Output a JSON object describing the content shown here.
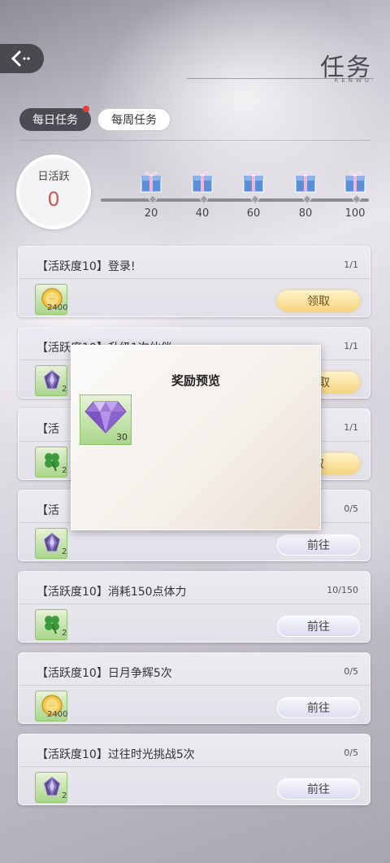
{
  "header": {
    "title": "任务",
    "subtitle": "RENWU",
    "back_icon": "back-arrow-icon"
  },
  "tabs": [
    {
      "label": "每日任务",
      "active": true,
      "has_badge": true
    },
    {
      "label": "每周任务",
      "active": false
    }
  ],
  "activity": {
    "label": "日活跃",
    "value": "0"
  },
  "milestones": [
    "20",
    "40",
    "60",
    "80",
    "100"
  ],
  "tasks": [
    {
      "title": "【活跃度10】登录!",
      "progress": "1/1",
      "reward_icon": "coin-icon",
      "reward_count": "2400",
      "button": "领取"
    },
    {
      "title": "【活跃度10】升级1次伙伴",
      "progress": "1/1",
      "reward_icon": "crystal-icon",
      "reward_count": "2",
      "button": "领取"
    },
    {
      "title": "【活",
      "progress": "1/1",
      "reward_icon": "clover-icon",
      "reward_count": "2",
      "button": "取"
    },
    {
      "title": "【活",
      "progress": "0/5",
      "reward_icon": "crystal-icon",
      "reward_count": "2",
      "button": "前往"
    },
    {
      "title": "【活跃度10】消耗150点体力",
      "progress": "10/150",
      "reward_icon": "clover-icon",
      "reward_count": "2",
      "button": "前往"
    },
    {
      "title": "【活跃度10】日月争辉5次",
      "progress": "0/5",
      "reward_icon": "coin-icon",
      "reward_count": "2400",
      "button": "前往"
    },
    {
      "title": "【活跃度10】过往时光挑战5次",
      "progress": "0/5",
      "reward_icon": "crystal-icon",
      "reward_count": "2",
      "button": "前往"
    }
  ],
  "modal": {
    "title": "奖励预览",
    "item_icon": "diamond-icon",
    "item_count": "30"
  }
}
